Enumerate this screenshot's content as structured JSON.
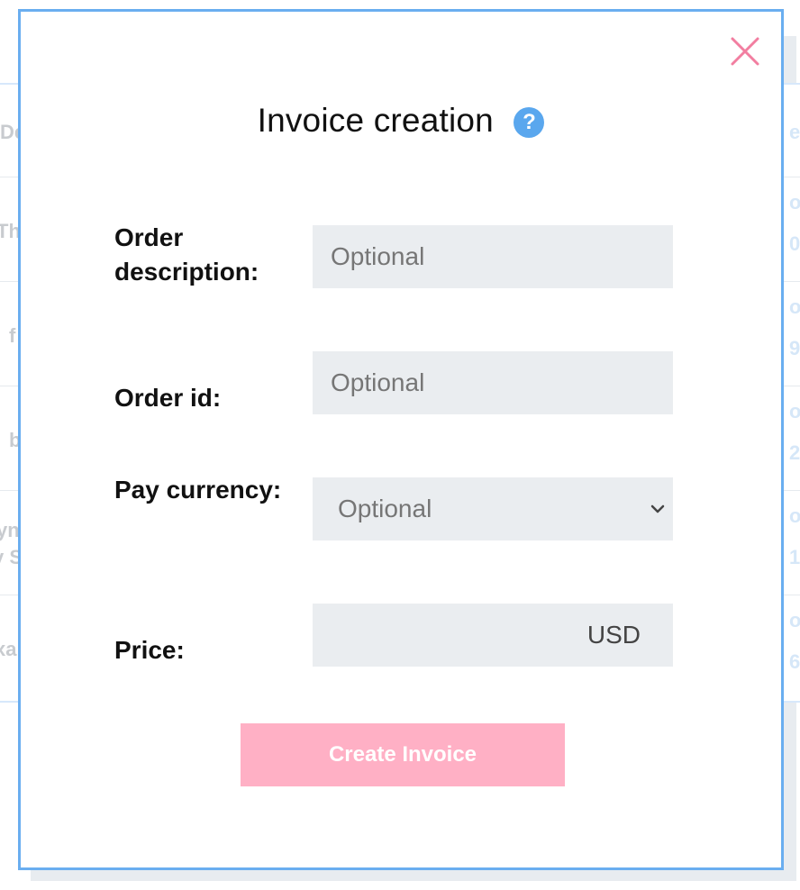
{
  "background": {
    "left_fragments": [
      "De",
      "Th",
      "f",
      "b",
      "yn",
      "y S",
      "xa"
    ],
    "right_fragments": [
      "e",
      "o",
      "0",
      "o",
      "9",
      "o",
      "2",
      "o",
      "1",
      "o",
      "6"
    ]
  },
  "modal": {
    "title": "Invoice creation",
    "help_glyph": "?",
    "fields": {
      "order_description": {
        "label": "Order description:",
        "placeholder": "Optional"
      },
      "order_id": {
        "label": "Order id:",
        "placeholder": "Optional"
      },
      "pay_currency": {
        "label": "Pay currency:",
        "selected": "Optional"
      },
      "price": {
        "label": "Price:",
        "currency": "USD"
      }
    },
    "submit_label": "Create Invoice"
  },
  "icons": {
    "close": "close-icon",
    "help": "help-icon",
    "chevron": "chevron-down-icon"
  },
  "colors": {
    "accent_border": "#6aaef0",
    "close": "#f27ea0",
    "help": "#5aa7ee",
    "submit_bg": "#ffb0c5",
    "field_bg": "#eaedf0"
  }
}
